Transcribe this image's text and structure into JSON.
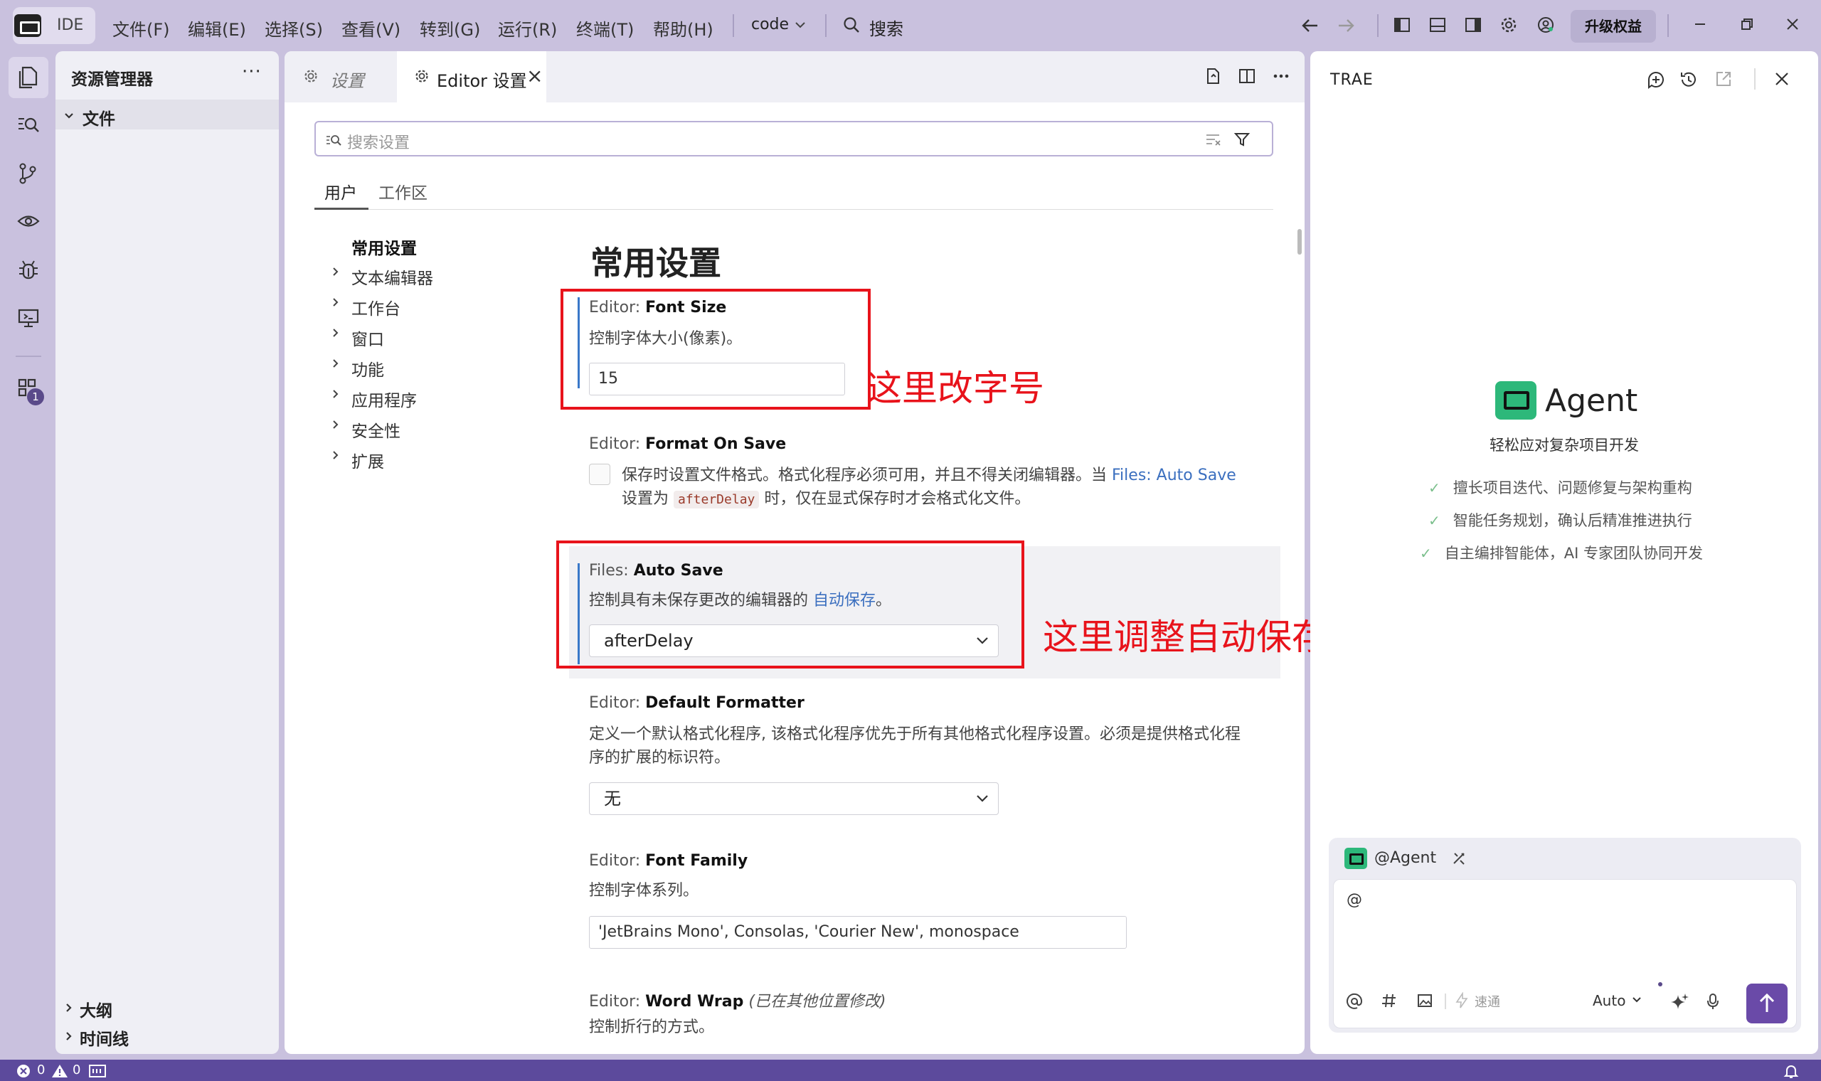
{
  "titlebar": {
    "app_name": "IDE",
    "menus": [
      "文件(F)",
      "编辑(E)",
      "选择(S)",
      "查看(V)",
      "转到(G)",
      "运行(R)",
      "终端(T)",
      "帮助(H)"
    ],
    "workspace": "code",
    "search_label": "搜索",
    "upgrade_label": "升级权益"
  },
  "explorer": {
    "title": "资源管理器",
    "more": "···",
    "folder": "文件",
    "outline": "大纲",
    "timeline": "时间线"
  },
  "activity": {
    "extensions_badge": "1"
  },
  "editor": {
    "tabs": [
      {
        "label": "设置",
        "active": false
      },
      {
        "label": "Editor 设置",
        "active": true,
        "close": "×"
      }
    ],
    "search_placeholder": "搜索设置",
    "scopes": [
      "用户",
      "工作区"
    ],
    "toc": [
      "常用设置",
      "文本编辑器",
      "工作台",
      "窗口",
      "功能",
      "应用程序",
      "安全性",
      "扩展"
    ],
    "section_title": "常用设置",
    "settings": {
      "font_size": {
        "prefix": "Editor: ",
        "name": "Font Size",
        "desc": "控制字体大小(像素)。",
        "value": "15"
      },
      "format_on_save": {
        "prefix": "Editor: ",
        "name": "Format On Save",
        "desc_1": "保存时设置文件格式。格式化程序必须可用，并且不得关闭编辑器。当 ",
        "desc_link": "Files: Auto Save",
        "desc_2": " 设置为 ",
        "desc_code": "afterDelay",
        "desc_3": " 时，仅在显式保存时才会格式化文件。",
        "checked": false
      },
      "auto_save": {
        "prefix": "Files: ",
        "name": "Auto Save",
        "desc": "控制具有未保存更改的编辑器的 ",
        "desc_link": "自动保存",
        "desc_end": "。",
        "value": "afterDelay"
      },
      "default_formatter": {
        "prefix": "Editor: ",
        "name": "Default Formatter",
        "desc": "定义一个默认格式化程序, 该格式化程序优先于所有其他格式化程序设置。必须是提供格式化程序的扩展的标识符。",
        "value": "无"
      },
      "font_family": {
        "prefix": "Editor: ",
        "name": "Font Family",
        "desc": "控制字体系列。",
        "value": "'JetBrains Mono', Consolas, 'Courier New', monospace"
      },
      "word_wrap": {
        "prefix": "Editor: ",
        "name": "Word Wrap",
        "note": "(已在其他位置修改)",
        "desc": "控制折行的方式。"
      }
    },
    "annotations": {
      "font_size": "这里改字号",
      "auto_save": "这里调整自动保存，改成afterDelay即可"
    },
    "annotation_color": "#e8131b"
  },
  "trae": {
    "title": "TRAE",
    "agent_name": "Agent",
    "agent_subtitle": "轻松应对复杂项目开发",
    "features": [
      "擅长项目迭代、问题修复与架构重构",
      "智能任务规划，确认后精准推进执行",
      "自主编排智能体，AI 专家团队协同开发"
    ],
    "chat": {
      "mention_label": "@Agent",
      "input_value": "@",
      "speed_label": "速通",
      "mode_label": "Auto"
    }
  },
  "statusbar": {
    "errors": "0",
    "warnings": "0"
  },
  "colors": {
    "accent": "#5c4a9c",
    "chrome": "#c9c1de",
    "agent_green": "#2db87a",
    "link": "#3b6fbf"
  }
}
